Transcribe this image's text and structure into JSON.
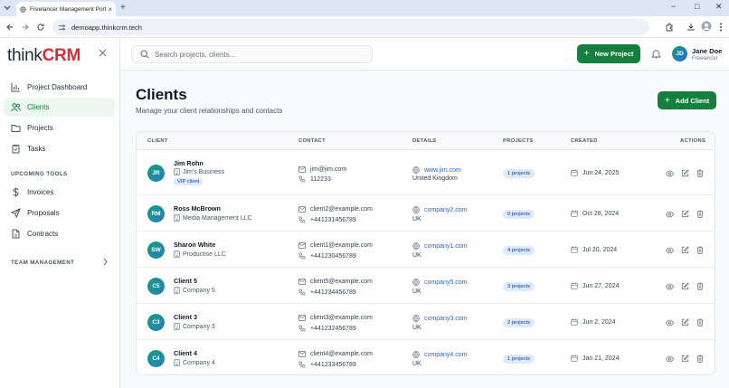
{
  "browser": {
    "tab_title": "Freelancer Management Portal",
    "url": "demoapp.thinkcrm.tech",
    "window_controls": [
      "−",
      "□",
      "✕"
    ]
  },
  "sidebar": {
    "logo_text": "think",
    "logo_brand": "CRM",
    "items": [
      {
        "label": "Project Dashboard",
        "icon": "bar-chart-icon"
      },
      {
        "label": "Clients",
        "icon": "users-icon",
        "active": true
      },
      {
        "label": "Projects",
        "icon": "folder-icon"
      },
      {
        "label": "Tasks",
        "icon": "clipboard-icon"
      }
    ],
    "section_upcoming": "UPCOMING TOOLS",
    "upcoming_items": [
      {
        "label": "Invoices",
        "icon": "dollar-icon"
      },
      {
        "label": "Proposals",
        "icon": "send-icon"
      },
      {
        "label": "Contracts",
        "icon": "document-icon"
      }
    ],
    "section_team": "TEAM MANAGEMENT"
  },
  "topbar": {
    "search_placeholder": "Search projects, clients...",
    "new_project_label": "New Project",
    "user": {
      "initials": "JD",
      "name": "Jane Doe",
      "role": "Freelancer"
    }
  },
  "main": {
    "title": "Clients",
    "subtitle": "Manage your client relationships and contacts",
    "add_client_label": "Add Client",
    "columns": [
      "CLIENT",
      "CONTACT",
      "DETAILS",
      "PROJECTS",
      "CREATED",
      "ACTIONS"
    ],
    "rows": [
      {
        "initials": "JR",
        "name": "Jim Rohn",
        "company": "Jim's Business",
        "vip": "VIP client",
        "email": "jim@jim.com",
        "phone": "112233",
        "website": "www.jim.com",
        "country": "United Kingdom",
        "projects": "1 projects",
        "created": "Jun 24, 2025"
      },
      {
        "initials": "RM",
        "name": "Ross McBrown",
        "company": "Media Management LLC",
        "email": "client2@example.com",
        "phone": "+441231456789",
        "website": "company2.com",
        "country": "UK",
        "projects": "0 projects",
        "created": "Oct 28, 2024"
      },
      {
        "initials": "SW",
        "name": "Sharon White",
        "company": "Productise LLC",
        "email": "client1@example.com",
        "phone": "+441230456789",
        "website": "company1.com",
        "country": "UK",
        "projects": "4 projects",
        "created": "Jul 20, 2024"
      },
      {
        "initials": "C5",
        "name": "Client 5",
        "company": "Company 5",
        "email": "client5@example.com",
        "phone": "+441234456789",
        "website": "company5.com",
        "country": "UK",
        "projects": "3 projects",
        "created": "Jun 27, 2024"
      },
      {
        "initials": "C3",
        "name": "Client 3",
        "company": "Company 3",
        "email": "client3@example.com",
        "phone": "+441232456789",
        "website": "company3.com",
        "country": "UK",
        "projects": "2 projects",
        "created": "Jun 2, 2024"
      },
      {
        "initials": "C4",
        "name": "Client 4",
        "company": "Company 4",
        "email": "client4@example.com",
        "phone": "+441233456789",
        "website": "company4.com",
        "country": "UK",
        "projects": "1 projects",
        "created": "Jan 21, 2024"
      }
    ]
  },
  "colors": {
    "accent_green": "#15803d",
    "brand_red": "#d92d3a",
    "link_blue": "#2563eb",
    "badge_bg": "#dbeafe"
  }
}
